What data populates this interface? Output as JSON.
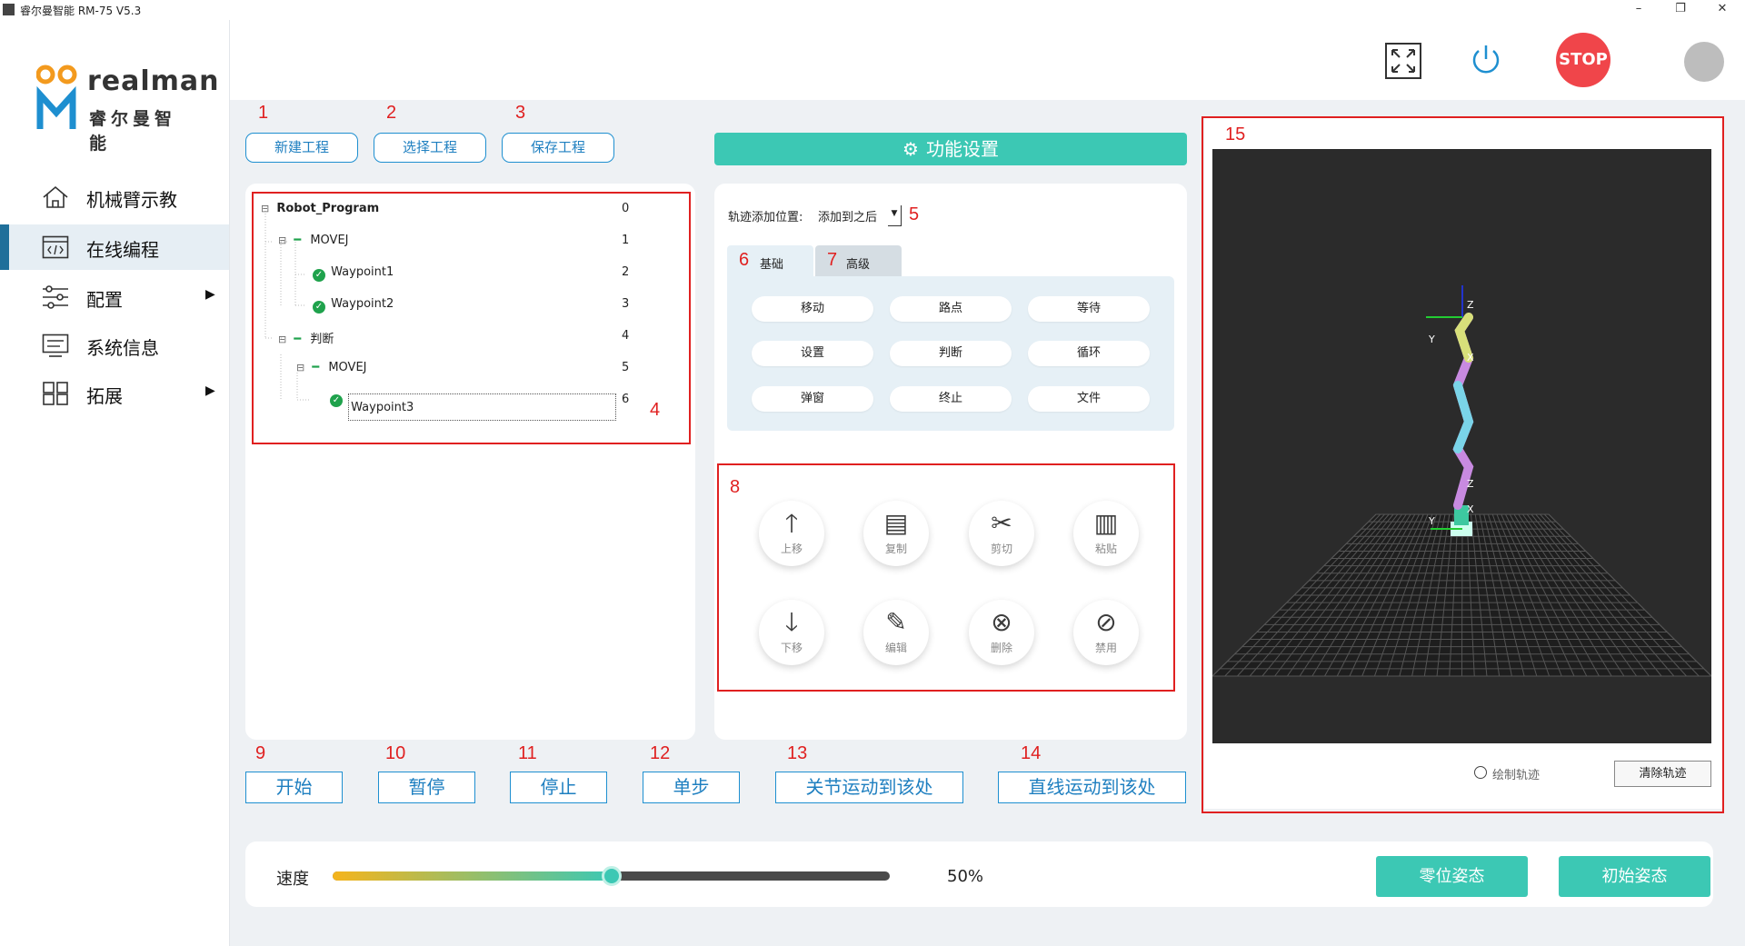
{
  "window": {
    "title": "睿尔曼智能 RM-75 V5.3",
    "minimize": "–",
    "restore": "❐",
    "close": "✕"
  },
  "logo": {
    "en": "realman",
    "cn": "睿尔曼智能"
  },
  "nav": [
    {
      "label": "机械臂示教",
      "icon": "home-icon",
      "arrow": ""
    },
    {
      "label": "在线编程",
      "icon": "code-icon",
      "arrow": ""
    },
    {
      "label": "配置",
      "icon": "sliders-icon",
      "arrow": "▶"
    },
    {
      "label": "系统信息",
      "icon": "list-icon",
      "arrow": ""
    },
    {
      "label": "拓展",
      "icon": "grid-icon",
      "arrow": "▶"
    }
  ],
  "header": {
    "stop_label": "STOP"
  },
  "annotations": [
    "1",
    "2",
    "3",
    "4",
    "5",
    "6",
    "7",
    "8",
    "9",
    "10",
    "11",
    "12",
    "13",
    "14",
    "15"
  ],
  "project_buttons": [
    "新建工程",
    "选择工程",
    "保存工程"
  ],
  "tree": [
    {
      "label": "Robot_Program",
      "index": "0",
      "toggle": "⊟",
      "bold": true,
      "check": false
    },
    {
      "label": "MOVEJ",
      "index": "1",
      "toggle": "⊟",
      "bold": false,
      "check": false
    },
    {
      "label": "Waypoint1",
      "index": "2",
      "toggle": "",
      "bold": false,
      "check": true
    },
    {
      "label": "Waypoint2",
      "index": "3",
      "toggle": "",
      "bold": false,
      "check": true
    },
    {
      "label": "判断",
      "index": "4",
      "toggle": "⊟",
      "bold": false,
      "check": false
    },
    {
      "label": "MOVEJ",
      "index": "5",
      "toggle": "⊟",
      "bold": false,
      "check": false
    },
    {
      "label": "Waypoint3",
      "index": "6",
      "toggle": "",
      "bold": false,
      "check": true
    }
  ],
  "func_header": "功能设置",
  "track_position": {
    "label": "轨迹添加位置:",
    "value": "添加到之后"
  },
  "tabs": [
    "基础",
    "高级"
  ],
  "func_buttons": [
    "移动",
    "路点",
    "等待",
    "设置",
    "判断",
    "循环",
    "弹窗",
    "终止",
    "文件"
  ],
  "edit_buttons": [
    {
      "label": "上移",
      "icon": "arrow-up-icon"
    },
    {
      "label": "复制",
      "icon": "copy-icon"
    },
    {
      "label": "剪切",
      "icon": "cut-icon"
    },
    {
      "label": "粘贴",
      "icon": "paste-icon"
    },
    {
      "label": "下移",
      "icon": "arrow-down-icon"
    },
    {
      "label": "编辑",
      "icon": "edit-icon"
    },
    {
      "label": "删除",
      "icon": "delete-icon"
    },
    {
      "label": "禁用",
      "icon": "disable-icon"
    }
  ],
  "run_buttons": [
    "开始",
    "暂停",
    "停止",
    "单步",
    "关节运动到该处",
    "直线运动到该处"
  ],
  "viewer": {
    "draw_track": "绘制轨迹",
    "clear_track": "清除轨迹",
    "axis_labels": [
      "Z",
      "Y",
      "X",
      "Z",
      "Y",
      "X"
    ]
  },
  "speed": {
    "label": "速度",
    "value_text": "50%",
    "fraction": 0.5
  },
  "pose_buttons": [
    "零位姿态",
    "初始姿态"
  ],
  "colors": {
    "teal": "#3cc8b4",
    "blue": "#1e8fd0",
    "red": "#e02020",
    "stop": "#f0454a"
  }
}
